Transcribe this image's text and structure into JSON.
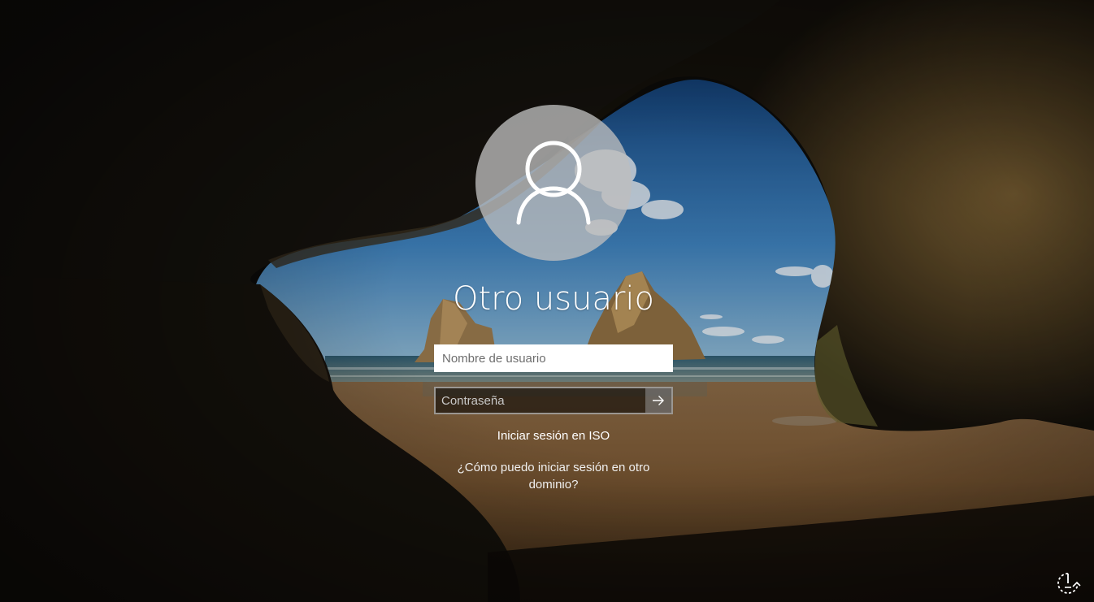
{
  "user": {
    "display_name": "Otro usuario",
    "avatar_icon": "user-silhouette-icon"
  },
  "fields": {
    "username_placeholder": "Nombre de usuario",
    "username_value": "",
    "password_placeholder": "Contraseña",
    "password_value": ""
  },
  "submit": {
    "icon": "arrow-right-icon"
  },
  "links": {
    "sign_in_to": "Iniciar sesión en ISO",
    "other_domain": "¿Cómo puedo iniciar sesión en otro dominio?"
  },
  "corner": {
    "icon": "power-options-icon"
  },
  "colors": {
    "sky": "#2f6fa8",
    "sand": "#8a6438",
    "rock": "#4a3a22",
    "text": "#ffffff"
  }
}
